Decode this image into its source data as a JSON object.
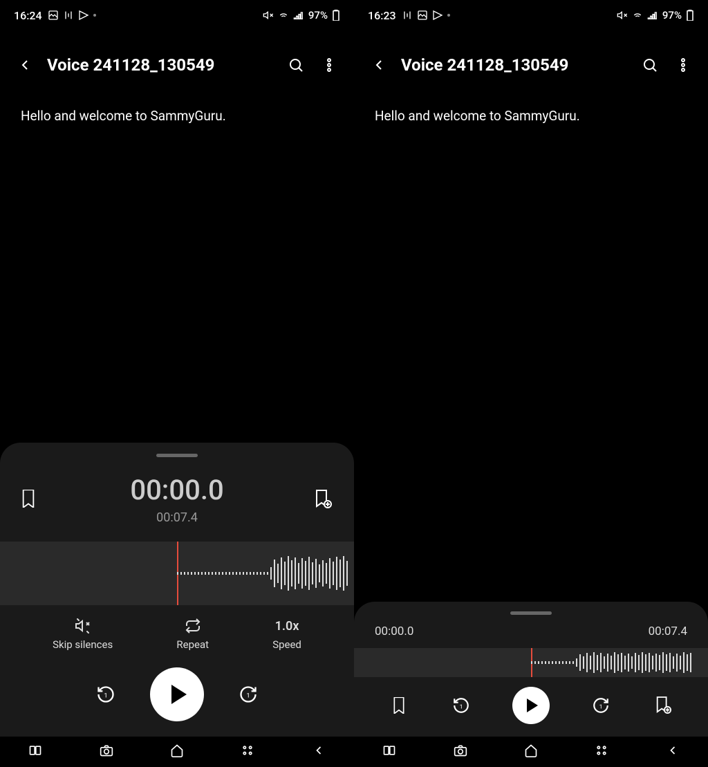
{
  "left": {
    "status": {
      "time": "16:24",
      "battery": "97%"
    },
    "header": {
      "title": "Voice 241128_130549"
    },
    "transcript": "Hello and welcome to SammyGuru.",
    "player": {
      "current_time": "00:00.",
      "current_dec": "0",
      "total_time": "00:07.4",
      "options": {
        "skip_label": "Skip silences",
        "repeat_label": "Repeat",
        "speed_value": "1.0x",
        "speed_label": "Speed"
      }
    }
  },
  "right": {
    "status": {
      "time": "16:23",
      "battery": "97%"
    },
    "header": {
      "title": "Voice 241128_130549"
    },
    "transcript": "Hello and welcome to SammyGuru.",
    "player": {
      "current_time": "00:00.0",
      "total_time": "00:07.4"
    }
  }
}
